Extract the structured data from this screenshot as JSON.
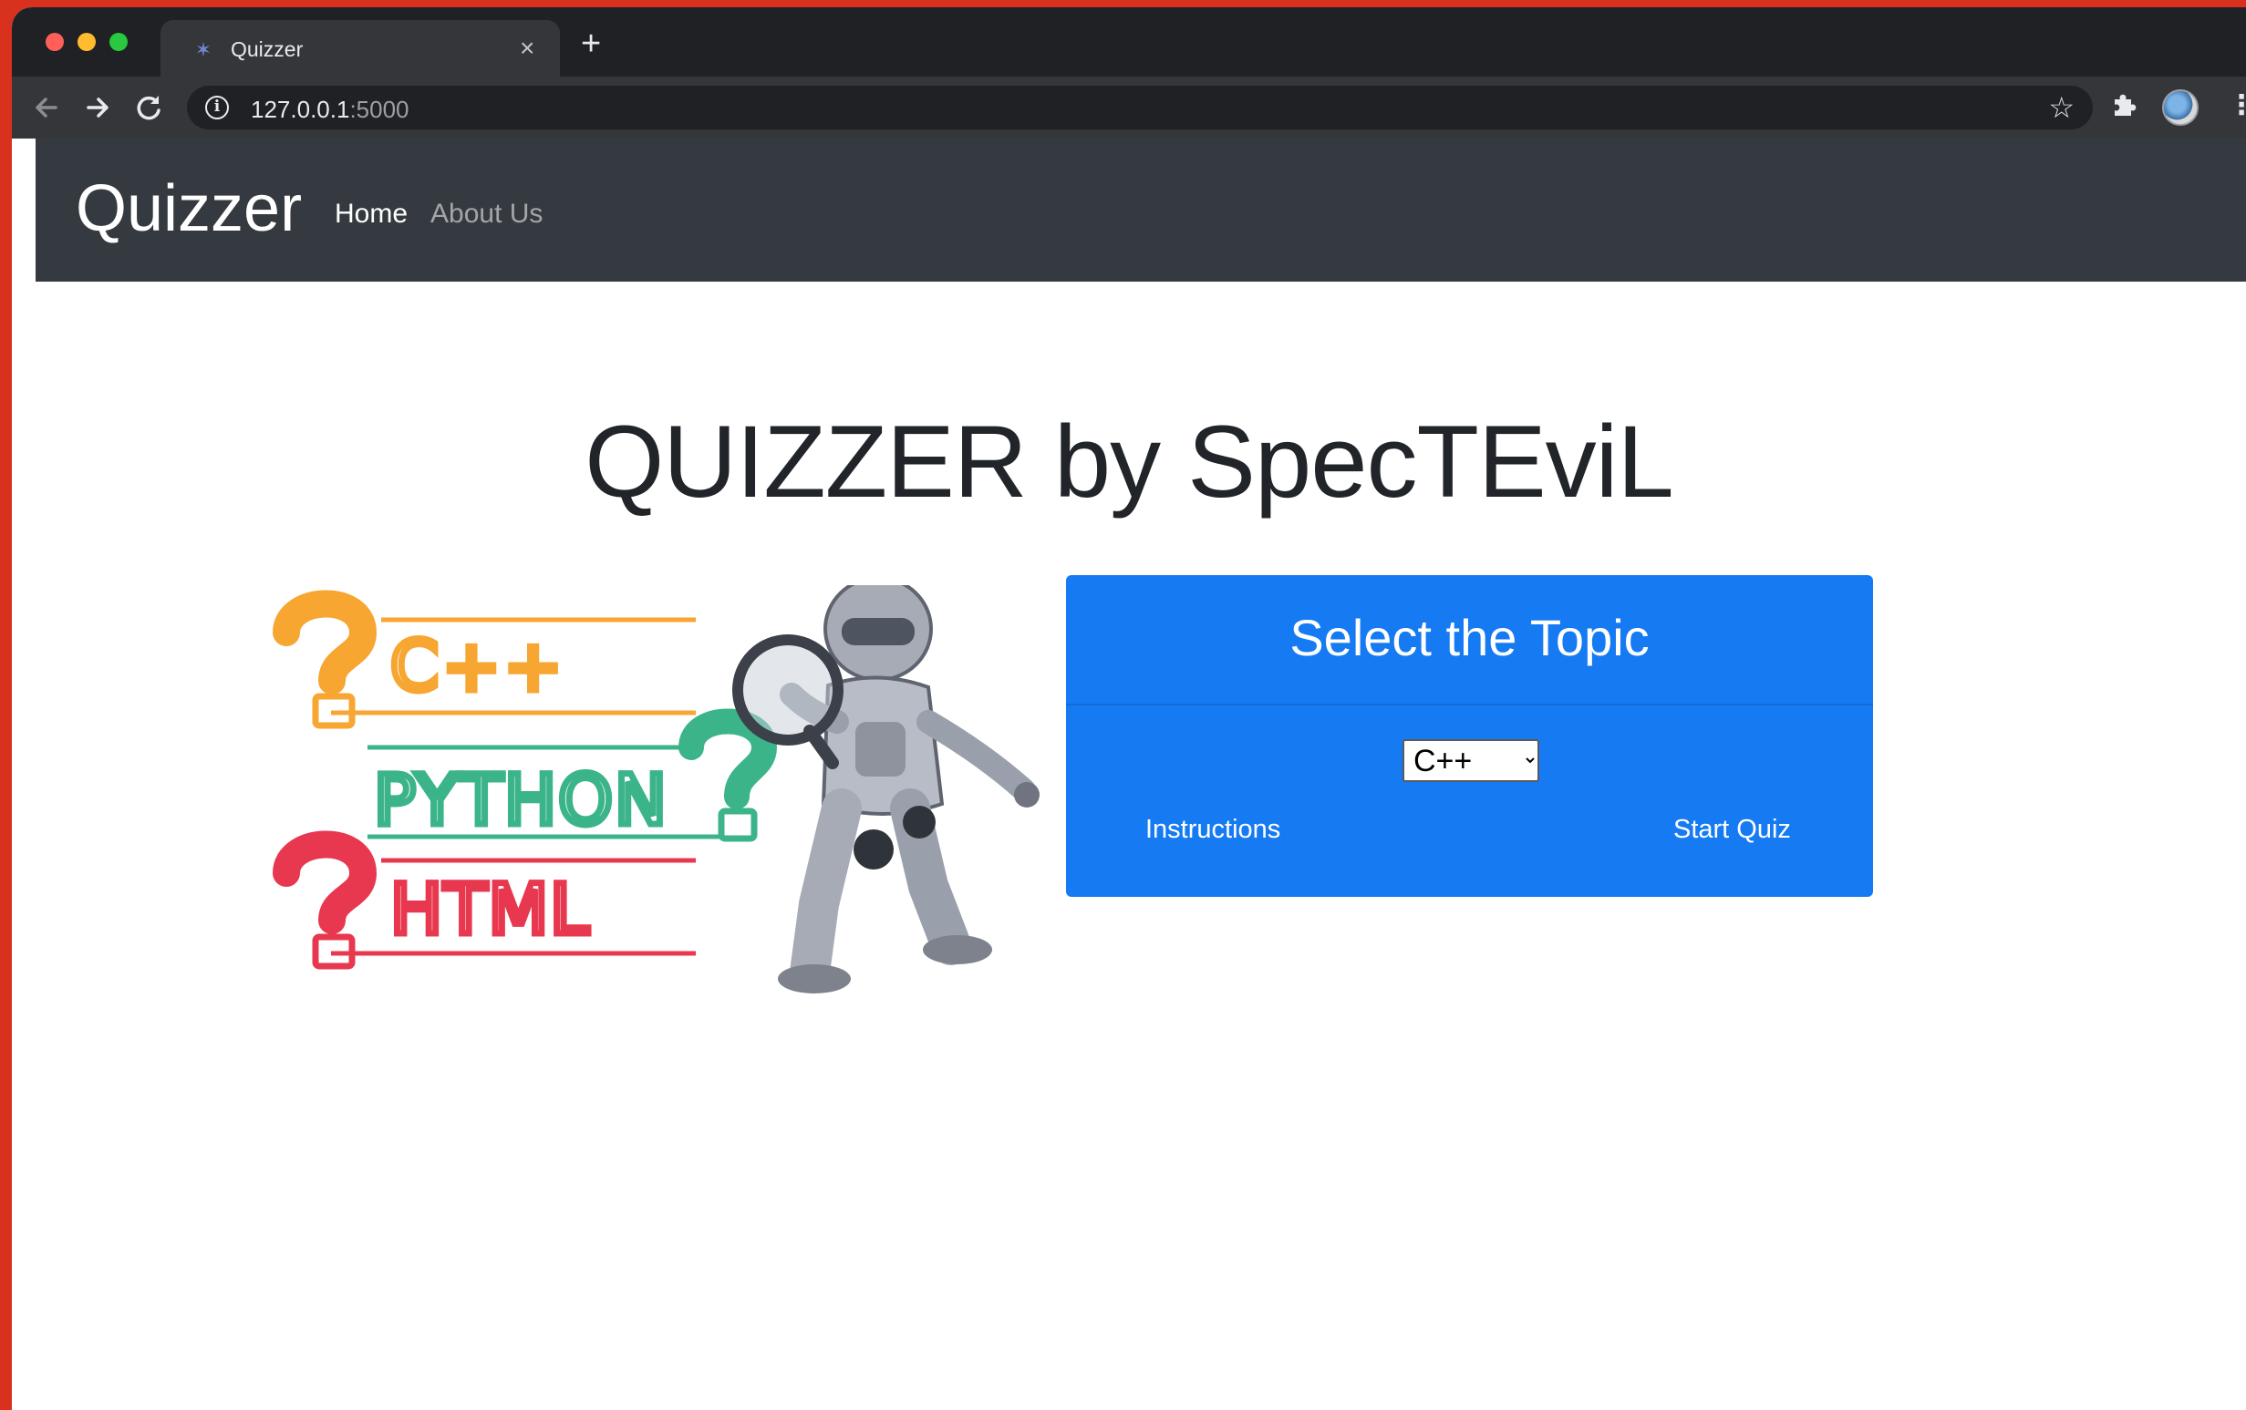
{
  "browser": {
    "tab_title": "Quizzer",
    "new_tab_symbol": "+",
    "close_symbol": "×",
    "url_host": "127.0.0.1",
    "url_port": ":5000",
    "icons": [
      "back-arrow-icon",
      "forward-arrow-icon",
      "reload-icon",
      "info-icon",
      "star-icon",
      "puzzle-extension-icon",
      "avatar",
      "kebab-menu-icon"
    ]
  },
  "navbar": {
    "brand": "Quizzer",
    "links": [
      {
        "label": "Home",
        "active": true
      },
      {
        "label": "About Us",
        "active": false
      }
    ]
  },
  "hero": {
    "title": "QUIZZER by SpecTEviL"
  },
  "illustration": {
    "labels": [
      "C++",
      "PYTHON",
      "HTML"
    ],
    "colors": {
      "cpp": "#f6a631",
      "python": "#3cb48a",
      "html": "#e8384f"
    }
  },
  "topic_card": {
    "title": "Select the Topic",
    "selected_topic": "C++",
    "instructions_label": "Instructions",
    "start_label": "Start Quiz",
    "color": "#167bf2"
  }
}
